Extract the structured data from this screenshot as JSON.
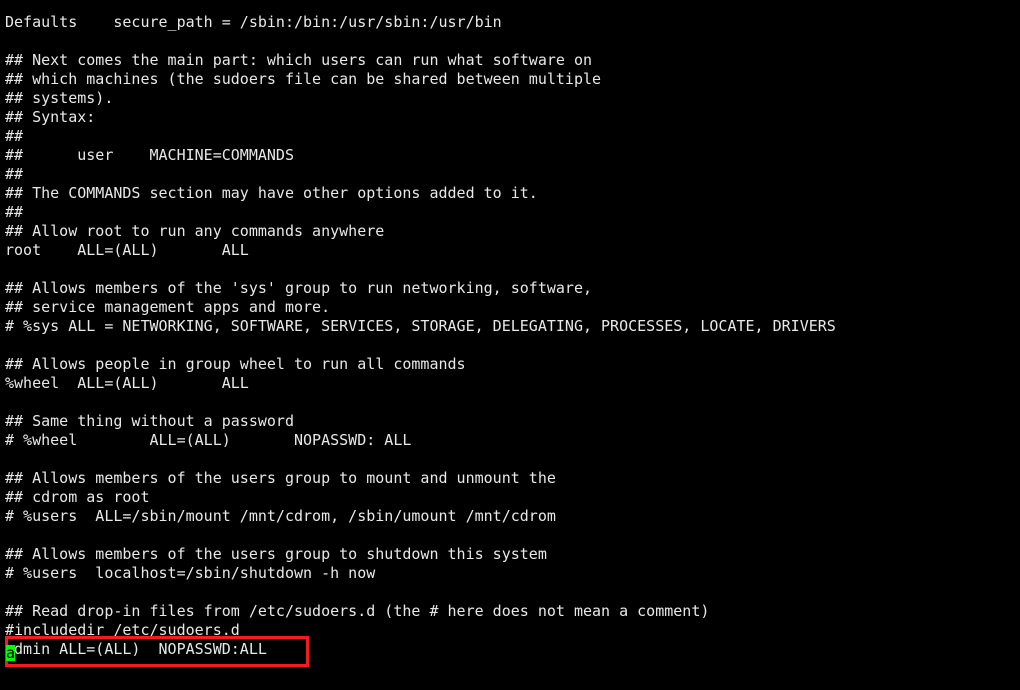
{
  "terminal": {
    "title": "sudoers file editor",
    "background_color": "#000000",
    "foreground_color": "#e8e8e8",
    "cursor_color": "#00ff00",
    "annotation_color": "#f01c22",
    "lines": [
      "Defaults    secure_path = /sbin:/bin:/usr/sbin:/usr/bin",
      "",
      "## Next comes the main part: which users can run what software on",
      "## which machines (the sudoers file can be shared between multiple",
      "## systems).",
      "## Syntax:",
      "##",
      "##      user    MACHINE=COMMANDS",
      "##",
      "## The COMMANDS section may have other options added to it.",
      "##",
      "## Allow root to run any commands anywhere",
      "root    ALL=(ALL)       ALL",
      "",
      "## Allows members of the 'sys' group to run networking, software,",
      "## service management apps and more.",
      "# %sys ALL = NETWORKING, SOFTWARE, SERVICES, STORAGE, DELEGATING, PROCESSES, LOCATE, DRIVERS",
      "",
      "## Allows people in group wheel to run all commands",
      "%wheel  ALL=(ALL)       ALL",
      "",
      "## Same thing without a password",
      "# %wheel        ALL=(ALL)       NOPASSWD: ALL",
      "",
      "## Allows members of the users group to mount and unmount the",
      "## cdrom as root",
      "# %users  ALL=/sbin/mount /mnt/cdrom, /sbin/umount /mnt/cdrom",
      "",
      "## Allows members of the users group to shutdown this system",
      "# %users  localhost=/sbin/shutdown -h now",
      "",
      "## Read drop-in files from /etc/sudoers.d (the # here does not mean a comment)",
      "#includedir /etc/sudoers.d",
      "admin ALL=(ALL)  NOPASSWD:ALL"
    ],
    "cursor": {
      "character": "a",
      "line_index": 32,
      "column": 0
    },
    "annotation": {
      "type": "highlight-rectangle",
      "target_line": "admin ALL=(ALL)  NOPASSWD:ALL",
      "color": "#f01c22"
    }
  }
}
